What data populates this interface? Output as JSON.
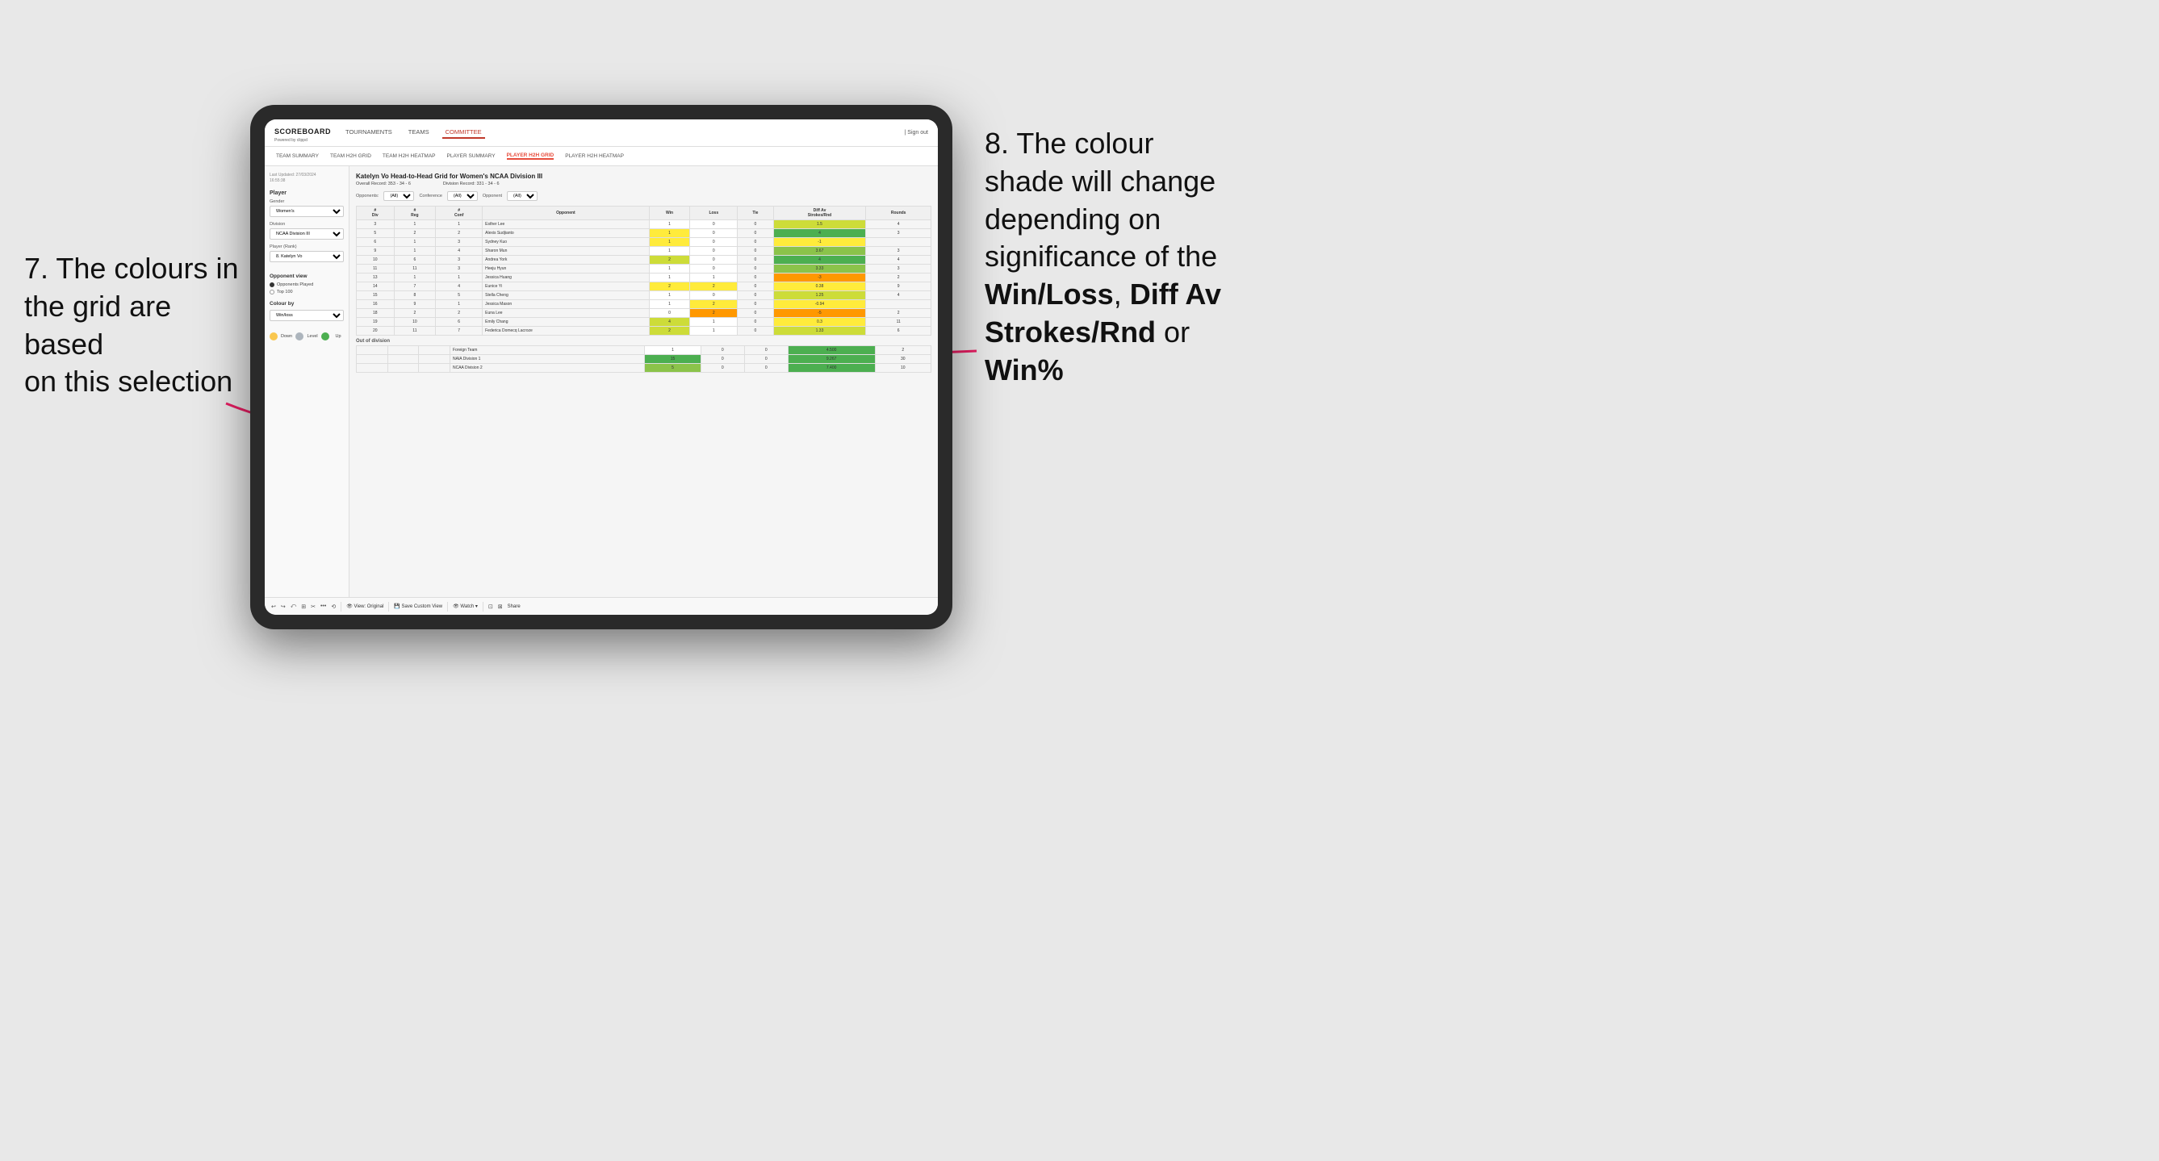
{
  "annotations": {
    "left": {
      "line1": "7. The colours in",
      "line2": "the grid are based",
      "line3": "on this selection"
    },
    "right": {
      "line1": "8. The colour",
      "line2": "shade will change",
      "line3": "depending on",
      "line4": "significance of the",
      "bold1": "Win/Loss",
      "comma1": ", ",
      "bold2": "Diff Av",
      "line5": "Strokes/Rnd",
      "line5b": " or",
      "bold3": "Win%"
    }
  },
  "nav": {
    "logo": "SCOREBOARD",
    "logo_sub": "Powered by clippd",
    "links": [
      "TOURNAMENTS",
      "TEAMS",
      "COMMITTEE"
    ],
    "active_link": "COMMITTEE",
    "sign_in": "| Sign out"
  },
  "sub_nav": {
    "links": [
      "TEAM SUMMARY",
      "TEAM H2H GRID",
      "TEAM H2H HEATMAP",
      "PLAYER SUMMARY",
      "PLAYER H2H GRID",
      "PLAYER H2H HEATMAP"
    ],
    "active": "PLAYER H2H GRID"
  },
  "left_panel": {
    "last_updated_label": "Last Updated: 27/03/2024",
    "last_updated_time": "16:55:38",
    "player_section": "Player",
    "gender_label": "Gender",
    "gender_value": "Women's",
    "division_label": "Division",
    "division_value": "NCAA Division III",
    "player_rank_label": "Player (Rank)",
    "player_rank_value": "8. Katelyn Vo",
    "opponent_view_title": "Opponent view",
    "radio1": "Opponents Played",
    "radio2": "Top 100",
    "colour_by_title": "Colour by",
    "colour_by_value": "Win/loss",
    "legend": {
      "down_color": "#f9c74f",
      "level_color": "#adb5bd",
      "up_color": "#4caf50",
      "down_label": "Down",
      "level_label": "Level",
      "up_label": "Up"
    }
  },
  "grid": {
    "title": "Katelyn Vo Head-to-Head Grid for Women's NCAA Division III",
    "overall_record_label": "Overall Record:",
    "overall_record": "353 - 34 - 6",
    "division_record_label": "Division Record:",
    "division_record": "331 - 34 - 6",
    "filters": {
      "opponents_label": "Opponents:",
      "opponents_value": "(All)",
      "conference_label": "Conference",
      "conference_value": "(All)",
      "opponent_label": "Opponent",
      "opponent_value": "(All)"
    },
    "table_headers": [
      "#\nDiv",
      "#\nReg",
      "#\nConf",
      "Opponent",
      "Win",
      "Loss",
      "Tie",
      "Diff Av\nStrokes/Rnd",
      "Rounds"
    ],
    "rows": [
      {
        "div": 3,
        "reg": 1,
        "conf": 1,
        "opponent": "Esther Lee",
        "win": 1,
        "loss": 0,
        "tie": 0,
        "diff": 1.5,
        "rounds": 4,
        "win_color": "cell-white",
        "loss_color": "cell-white",
        "diff_color": "cell-green-light"
      },
      {
        "div": 5,
        "reg": 2,
        "conf": 2,
        "opponent": "Alexis Sudjianto",
        "win": 1,
        "loss": 0,
        "tie": 0,
        "diff": 4.0,
        "rounds": 3,
        "win_color": "cell-yellow",
        "loss_color": "cell-white",
        "diff_color": "cell-green-dark"
      },
      {
        "div": 6,
        "reg": 1,
        "conf": 3,
        "opponent": "Sydney Kuo",
        "win": 1,
        "loss": 0,
        "tie": 0,
        "diff": -1.0,
        "rounds": "",
        "win_color": "cell-yellow",
        "loss_color": "cell-white",
        "diff_color": "cell-yellow"
      },
      {
        "div": 9,
        "reg": 1,
        "conf": 4,
        "opponent": "Sharon Mun",
        "win": 1,
        "loss": 0,
        "tie": 0,
        "diff": 3.67,
        "rounds": 3,
        "win_color": "cell-white",
        "loss_color": "cell-white",
        "diff_color": "cell-green-med"
      },
      {
        "div": 10,
        "reg": 6,
        "conf": 3,
        "opponent": "Andrea York",
        "win": 2,
        "loss": 0,
        "tie": 0,
        "diff": 4.0,
        "rounds": 4,
        "win_color": "cell-green-light",
        "loss_color": "cell-white",
        "diff_color": "cell-green-dark"
      },
      {
        "div": 11,
        "reg": 11,
        "conf": 3,
        "opponent": "Heeju Hyun",
        "win": 1,
        "loss": 0,
        "tie": 0,
        "diff": 3.33,
        "rounds": 3,
        "win_color": "cell-white",
        "loss_color": "cell-white",
        "diff_color": "cell-green-med"
      },
      {
        "div": 13,
        "reg": 1,
        "conf": 1,
        "opponent": "Jessica Huang",
        "win": 1,
        "loss": 1,
        "tie": 0,
        "diff": -3.0,
        "rounds": 2,
        "win_color": "cell-white",
        "loss_color": "cell-white",
        "diff_color": "cell-orange"
      },
      {
        "div": 14,
        "reg": 7,
        "conf": 4,
        "opponent": "Eunice Yi",
        "win": 2,
        "loss": 2,
        "tie": 0,
        "diff": 0.38,
        "rounds": 9,
        "win_color": "cell-yellow",
        "loss_color": "cell-yellow",
        "diff_color": "cell-yellow"
      },
      {
        "div": 15,
        "reg": 8,
        "conf": 5,
        "opponent": "Stella Cheng",
        "win": 1,
        "loss": 0,
        "tie": 0,
        "diff": 1.25,
        "rounds": 4,
        "win_color": "cell-white",
        "loss_color": "cell-white",
        "diff_color": "cell-green-light"
      },
      {
        "div": 16,
        "reg": 9,
        "conf": 1,
        "opponent": "Jessica Mason",
        "win": 1,
        "loss": 2,
        "tie": 0,
        "diff": -0.94,
        "rounds": "",
        "win_color": "cell-white",
        "loss_color": "cell-yellow",
        "diff_color": "cell-yellow"
      },
      {
        "div": 18,
        "reg": 2,
        "conf": 2,
        "opponent": "Euna Lee",
        "win": 0,
        "loss": 2,
        "tie": 0,
        "diff": -5.0,
        "rounds": 2,
        "win_color": "cell-white",
        "loss_color": "cell-orange",
        "diff_color": "cell-orange"
      },
      {
        "div": 19,
        "reg": 10,
        "conf": 6,
        "opponent": "Emily Chang",
        "win": 4,
        "loss": 1,
        "tie": 0,
        "diff": 0.3,
        "rounds": 11,
        "win_color": "cell-green-light",
        "loss_color": "cell-white",
        "diff_color": "cell-yellow"
      },
      {
        "div": 20,
        "reg": 11,
        "conf": 7,
        "opponent": "Federica Domecq Lacroze",
        "win": 2,
        "loss": 1,
        "tie": 0,
        "diff": 1.33,
        "rounds": 6,
        "win_color": "cell-green-light",
        "loss_color": "cell-white",
        "diff_color": "cell-green-light"
      }
    ],
    "out_of_division_label": "Out of division",
    "out_of_division_rows": [
      {
        "opponent": "Foreign Team",
        "win": 1,
        "loss": 0,
        "tie": 0,
        "diff": 4.5,
        "rounds": 2,
        "win_color": "cell-white",
        "diff_color": "cell-green-dark"
      },
      {
        "opponent": "NAIA Division 1",
        "win": 15,
        "loss": 0,
        "tie": 0,
        "diff": 9.267,
        "rounds": 30,
        "win_color": "cell-green-dark",
        "diff_color": "cell-green-dark"
      },
      {
        "opponent": "NCAA Division 2",
        "win": 5,
        "loss": 0,
        "tie": 0,
        "diff": 7.4,
        "rounds": 10,
        "win_color": "cell-green-med",
        "diff_color": "cell-green-dark"
      }
    ]
  },
  "toolbar": {
    "icons": [
      "↩",
      "↪",
      "⤺",
      "⊞",
      "✂",
      "·",
      "⟲",
      "|",
      "👁 View: Original",
      "|",
      "💾 Save Custom View",
      "|",
      "👁 Watch ▾",
      "|",
      "⊡",
      "⊠",
      "Share"
    ]
  }
}
